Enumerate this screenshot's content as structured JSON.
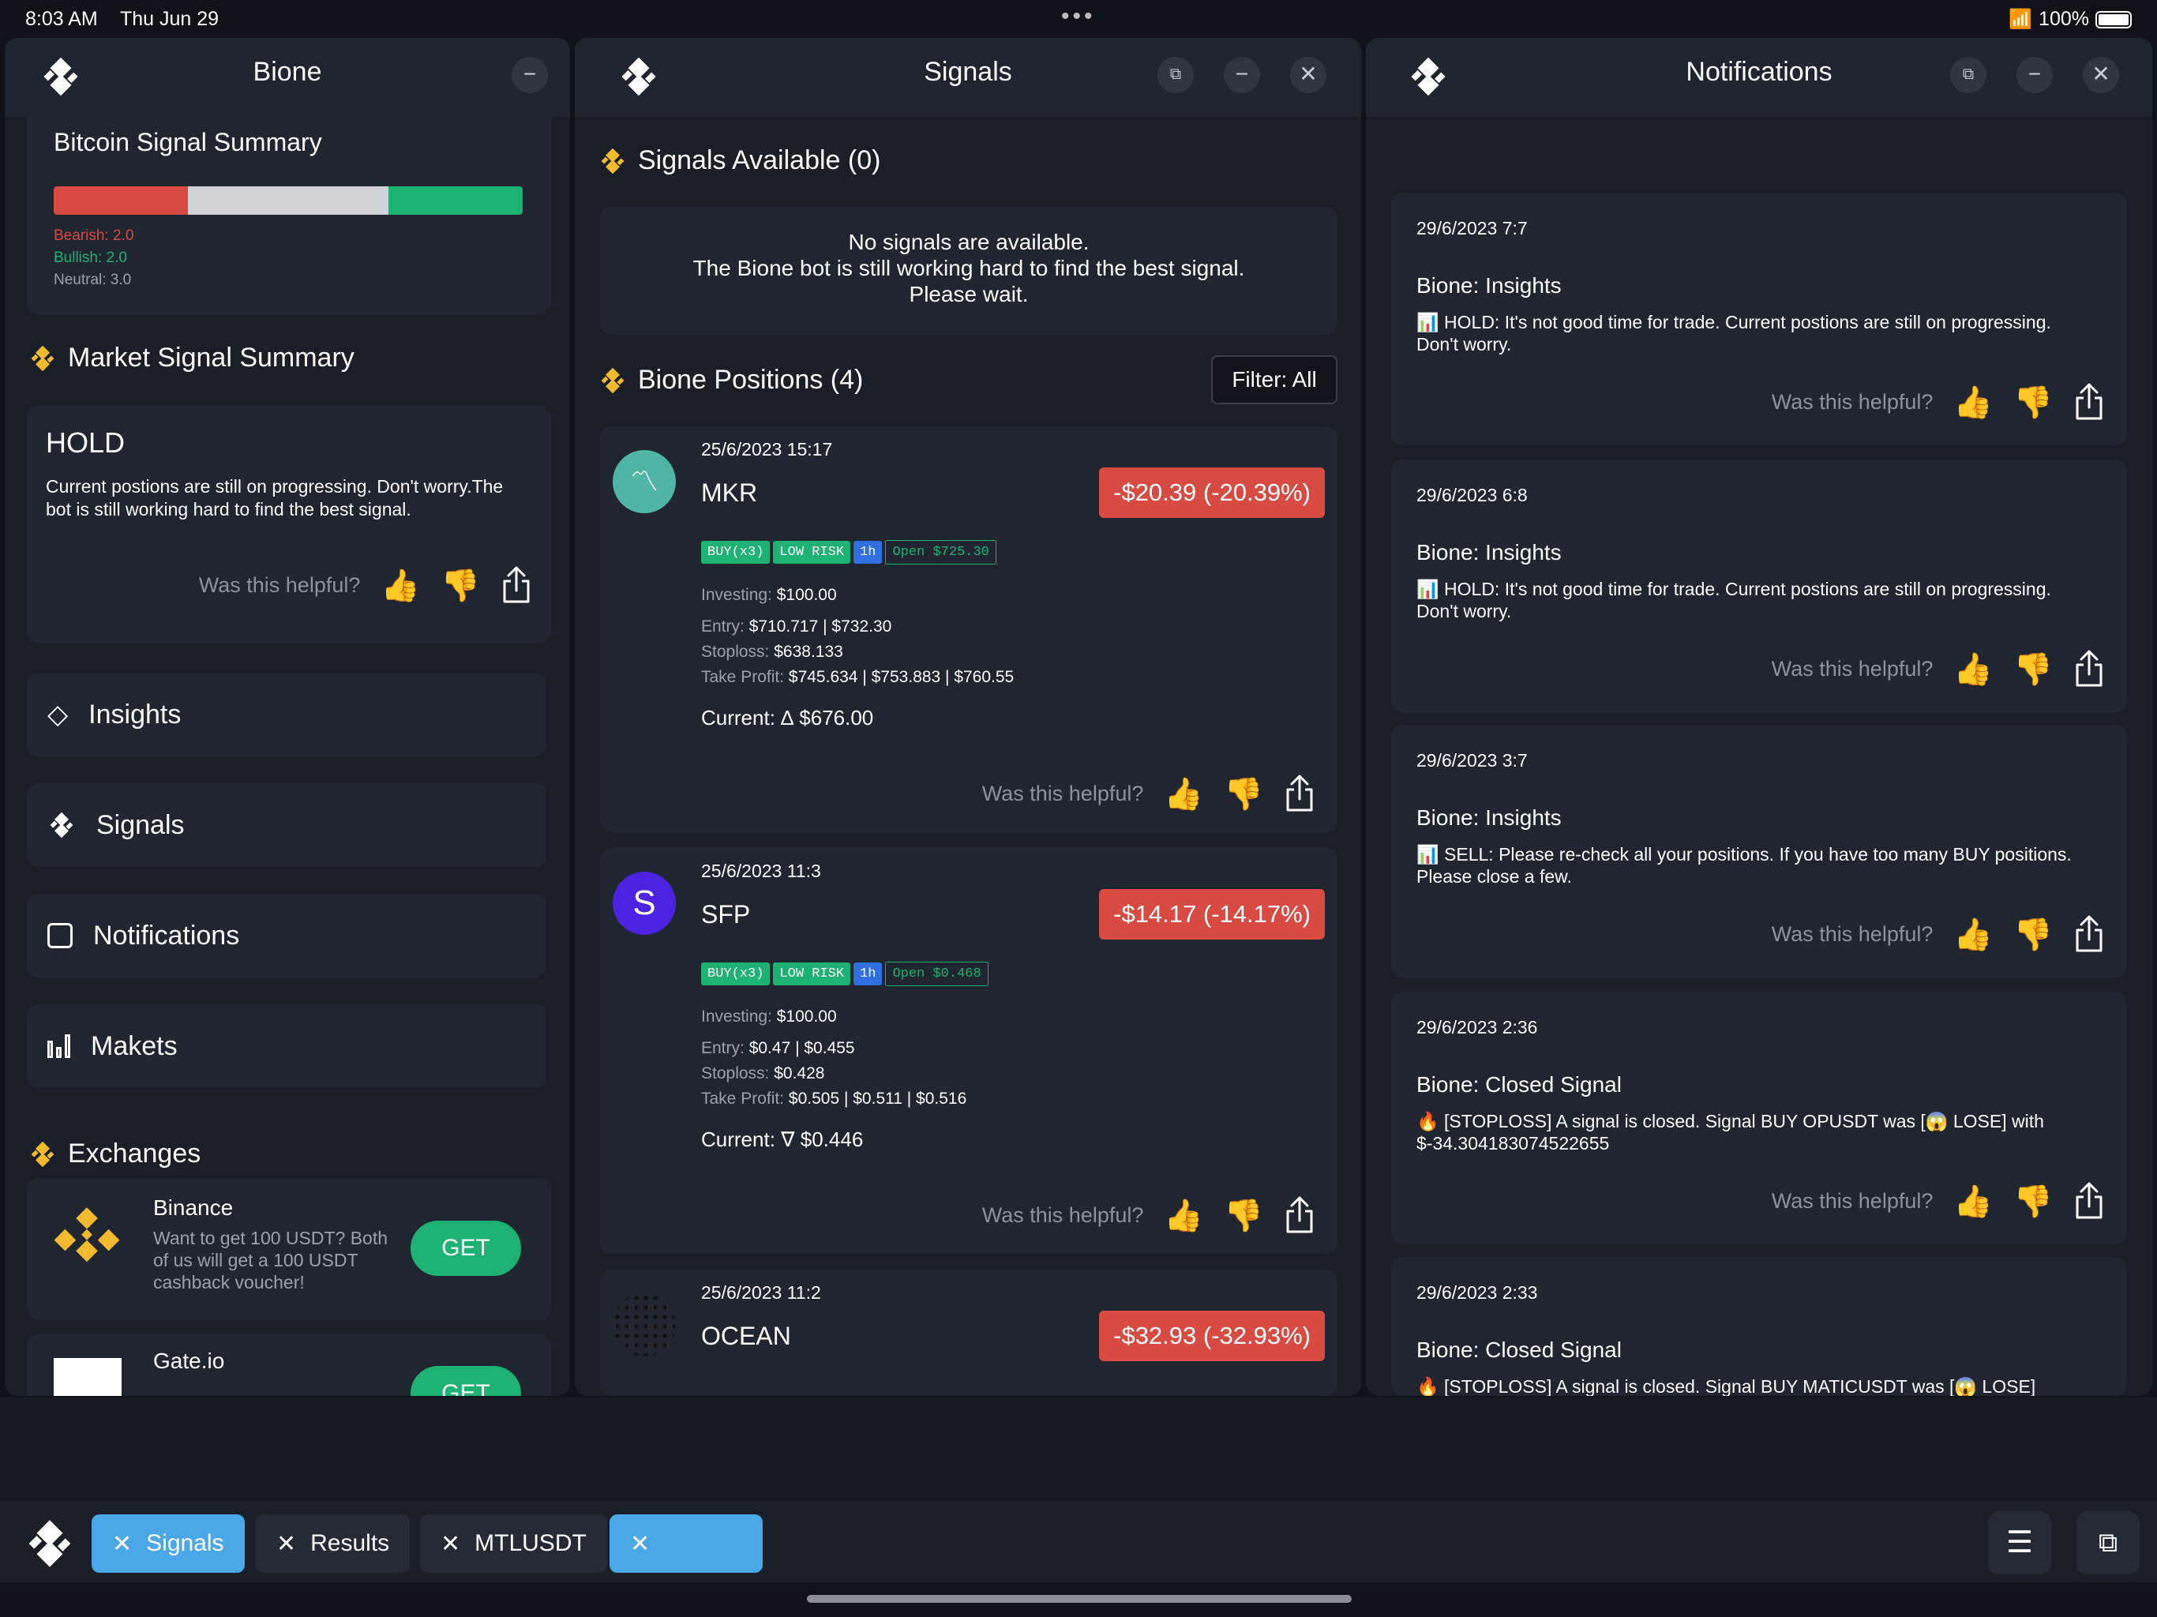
{
  "status_bar": {
    "time": "8:03 AM",
    "date": "Thu Jun 29",
    "battery": "100%"
  },
  "left_panel": {
    "title": "Bione",
    "bitcoin": {
      "title": "Bitcoin Signal Summary",
      "bearish": "Bearish: 2.0",
      "bullish": "Bullish: 2.0",
      "neutral": "Neutral: 3.0",
      "bar_values": {
        "bearish": 2.0,
        "neutral": 3.0,
        "bullish": 2.0
      }
    },
    "market": {
      "title": "Market Signal Summary",
      "status": "HOLD",
      "text": "Current postions are still on progressing. Don't worry.The bot is still working hard to find the best signal.",
      "helpful": "Was this helpful?"
    },
    "nav": [
      {
        "label": "Insights",
        "icon": "diamond-icon"
      },
      {
        "label": "Signals",
        "icon": "bione-logo-icon"
      },
      {
        "label": "Notifications",
        "icon": "notification-icon"
      },
      {
        "label": "Makets",
        "icon": "bar-chart-icon"
      }
    ],
    "exchanges": {
      "title": "Exchanges",
      "items": [
        {
          "name": "Binance",
          "desc": "Want to get 100 USDT? Both of us will get a 100 USDT cashback voucher!",
          "button": "GET"
        },
        {
          "name": "Gate.io",
          "desc": "",
          "button": "GET"
        }
      ]
    }
  },
  "signals_panel": {
    "title": "Signals",
    "available_title": "Signals Available (0)",
    "empty_line1": "No signals are available.",
    "empty_line2": "The Bione bot is still working hard to find the best signal.",
    "empty_line3": "Please wait.",
    "positions_title": "Bione Positions (4)",
    "filter_label": "Filter: All",
    "positions": [
      {
        "date": "25/6/2023 15:17",
        "symbol": "MKR",
        "pnl": "-$20.39 (-20.39%)",
        "tags": [
          "BUY(x3)",
          "LOW RISK",
          "1h"
        ],
        "open": "Open $725.30",
        "investing_label": "Investing:",
        "investing": "$100.00",
        "entry_label": "Entry:",
        "entry": "$710.717 | $732.30",
        "stoploss_label": "Stoploss:",
        "stoploss": "$638.133",
        "tp_label": "Take Profit:",
        "tp": "$745.634 | $753.883 | $760.55",
        "current": "Current: ∆ $676.00",
        "helpful": "Was this helpful?"
      },
      {
        "date": "25/6/2023 11:3",
        "symbol": "SFP",
        "pnl": "-$14.17 (-14.17%)",
        "tags": [
          "BUY(x3)",
          "LOW RISK",
          "1h"
        ],
        "open": "Open $0.468",
        "investing_label": "Investing:",
        "investing": "$100.00",
        "entry_label": "Entry:",
        "entry": "$0.47 | $0.455",
        "stoploss_label": "Stoploss:",
        "stoploss": "$0.428",
        "tp_label": "Take Profit:",
        "tp": "$0.505 | $0.511 | $0.516",
        "current": "Current: ∇ $0.446",
        "helpful": "Was this helpful?"
      },
      {
        "date": "25/6/2023 11:2",
        "symbol": "OCEAN",
        "pnl": "-$32.93 (-32.93%)"
      }
    ]
  },
  "notifications_panel": {
    "title": "Notifications",
    "items": [
      {
        "date": "29/6/2023 7:7",
        "title": "Bione: Insights",
        "text": "📊 HOLD: It's not good time for trade. Current postions are still on progressing. Don't worry.",
        "helpful": "Was this helpful?"
      },
      {
        "date": "29/6/2023 6:8",
        "title": "Bione: Insights",
        "text": "📊 HOLD: It's not good time for trade. Current postions are still on progressing. Don't worry.",
        "helpful": "Was this helpful?"
      },
      {
        "date": "29/6/2023 3:7",
        "title": "Bione: Insights",
        "text": "📊 SELL: Please re-check all your positions. If you have too many BUY positions. Please close a few.",
        "helpful": "Was this helpful?"
      },
      {
        "date": "29/6/2023 2:36",
        "title": "Bione: Closed Signal",
        "text": "🔥 [STOPLOSS] A signal is closed. Signal BUY OPUSDT was [😱 LOSE] with $-34.304183074522655",
        "helpful": "Was this helpful?"
      },
      {
        "date": "29/6/2023 2:33",
        "title": "Bione: Closed Signal",
        "text": "🔥 [STOPLOSS] A signal is closed. Signal BUY MATICUSDT was [😱 LOSE]"
      }
    ]
  },
  "taskbar": {
    "tabs": [
      {
        "label": "Signals",
        "active": true
      },
      {
        "label": "Results",
        "active": false
      },
      {
        "label": "MTLUSDT",
        "active": false
      },
      {
        "label": "",
        "active": true
      }
    ]
  },
  "colors": {
    "accent_yellow": "#f3ba2f",
    "buy_green": "#1db173",
    "loss_red": "#d84b43",
    "active_tab_blue": "#4aa8e8"
  }
}
